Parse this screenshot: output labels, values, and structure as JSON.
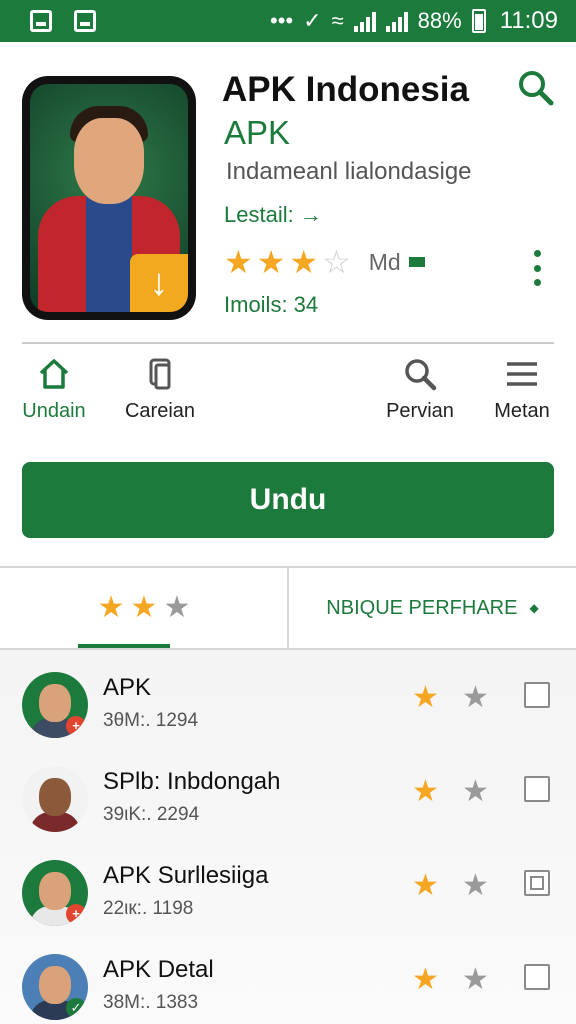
{
  "status_bar": {
    "battery": "88%",
    "time": "11:09",
    "dots": "•••"
  },
  "app": {
    "title": "APK Indonesia",
    "subtitle": "APK",
    "description": "Indameanl lialondasige",
    "detail": "Lestail: →",
    "rating_stars": 3,
    "rating_max": 4,
    "rating_label": "Md",
    "installs": "Imoils: 34"
  },
  "nav": {
    "items": [
      {
        "label": "Undain",
        "icon": "home-icon",
        "active": true
      },
      {
        "label": "Careian",
        "icon": "copy-icon",
        "active": false
      },
      {
        "label": "Pervian",
        "icon": "search-icon",
        "active": false
      },
      {
        "label": "Metan",
        "icon": "menu-icon",
        "active": false
      }
    ]
  },
  "download_button": "Undu",
  "tabs": {
    "rating_filter_stars": 2,
    "rating_filter_max": 3,
    "sort_label": "NBIQUE PERFHARE"
  },
  "list": [
    {
      "title": "APK",
      "meta": "3θM:. 1294",
      "stars_on": 1,
      "check": "empty",
      "avatar_color": "#1c7a3c",
      "badge_color": "#e2452f",
      "badge": "+"
    },
    {
      "title": "SPlb: Inbdongah",
      "meta": "39ιK:. 2294",
      "stars_on": 1,
      "check": "empty",
      "avatar_color": "#f2f2f2",
      "badge_color": "",
      "badge": ""
    },
    {
      "title": "APK Surllesiiga",
      "meta": "22ιк:. 1198",
      "stars_on": 1,
      "check": "filled",
      "avatar_color": "#1c7a3c",
      "badge_color": "#e2452f",
      "badge": "+"
    },
    {
      "title": "APK Detal",
      "meta": "38M:. 1383",
      "stars_on": 1,
      "check": "empty",
      "avatar_color": "#4b7fb5",
      "badge_color": "#1c7a3c",
      "badge": "✓"
    }
  ],
  "colors": {
    "brand_green": "#1c7a3c",
    "star_gold": "#f5a623",
    "star_grey": "#cfcfcf"
  }
}
